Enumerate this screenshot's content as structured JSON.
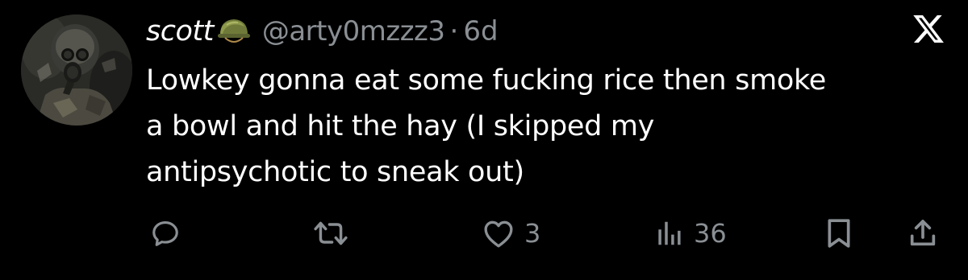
{
  "author": {
    "display_name": "scott",
    "badge_icon": "army-helmet-icon",
    "handle": "@arty0mzzz3",
    "separator": "·",
    "time_ago": "6d"
  },
  "brand_icon": "x-logo-icon",
  "tweet": {
    "lines": [
      "Lowkey gonna eat some fucking rice then smoke",
      "a bowl and hit the hay (I skipped my",
      "antipsychotic to sneak out)"
    ]
  },
  "actions": {
    "reply": {
      "icon": "reply-icon",
      "count": ""
    },
    "retweet": {
      "icon": "retweet-icon",
      "count": ""
    },
    "like": {
      "icon": "heart-icon",
      "count": "3"
    },
    "views": {
      "icon": "views-bar-chart-icon",
      "count": "36"
    },
    "bookmark": {
      "icon": "bookmark-icon",
      "count": ""
    },
    "share": {
      "icon": "share-icon",
      "count": ""
    }
  },
  "colors": {
    "background": "#000000",
    "text": "#ffffff",
    "muted": "#8a8f94"
  }
}
